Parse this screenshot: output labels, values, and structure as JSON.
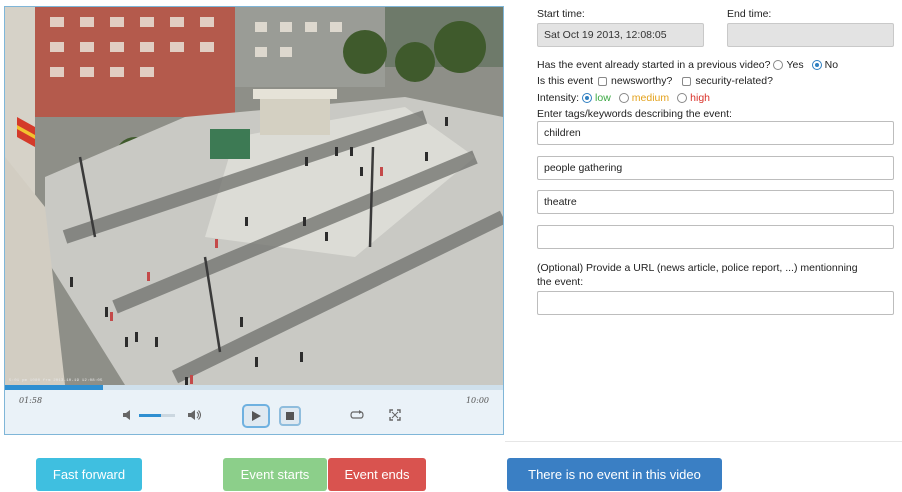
{
  "video": {
    "timestamp_overlay": "5:01 pm  1080 frm  2013-10-19 12:08:05",
    "time_elapsed": "01:58",
    "time_total": "10:00",
    "progress": 0.197,
    "volume": 0.6
  },
  "form": {
    "start_time_label": "Start time:",
    "start_time_value": "Sat Oct 19 2013, 12:08:05",
    "end_time_label": "End time:",
    "end_time_value": "",
    "previous_video_question": "Has the event already started in a previous video?",
    "previous_video_options": {
      "yes": "Yes",
      "no": "No",
      "selected": "No"
    },
    "event_type_prefix": "Is this event",
    "event_type_options": [
      "newsworthy?",
      "security-related?"
    ],
    "intensity_label": "Intensity:",
    "intensity_options": [
      {
        "label": "low",
        "color": "#3aa842",
        "selected": true
      },
      {
        "label": "medium",
        "color": "#e3a11b",
        "selected": false
      },
      {
        "label": "high",
        "color": "#d9322a",
        "selected": false
      }
    ],
    "tags_label": "Enter tags/keywords describing the event:",
    "tags": [
      "children",
      "people gathering",
      "theatre",
      ""
    ],
    "url_label_line1": "(Optional) Provide a URL (news article, police report, ...) mentionning",
    "url_label_line2": "the event:",
    "url_value": ""
  },
  "buttons": {
    "fast_forward": {
      "label": "Fast forward",
      "color": "#3fbfe0"
    },
    "event_starts": {
      "label": "Event starts",
      "color": "#8ccf8a"
    },
    "event_ends": {
      "label": "Event ends",
      "color": "#d9534f"
    },
    "no_event": {
      "label": "There is no event in this video",
      "color": "#3a7fc4"
    }
  }
}
